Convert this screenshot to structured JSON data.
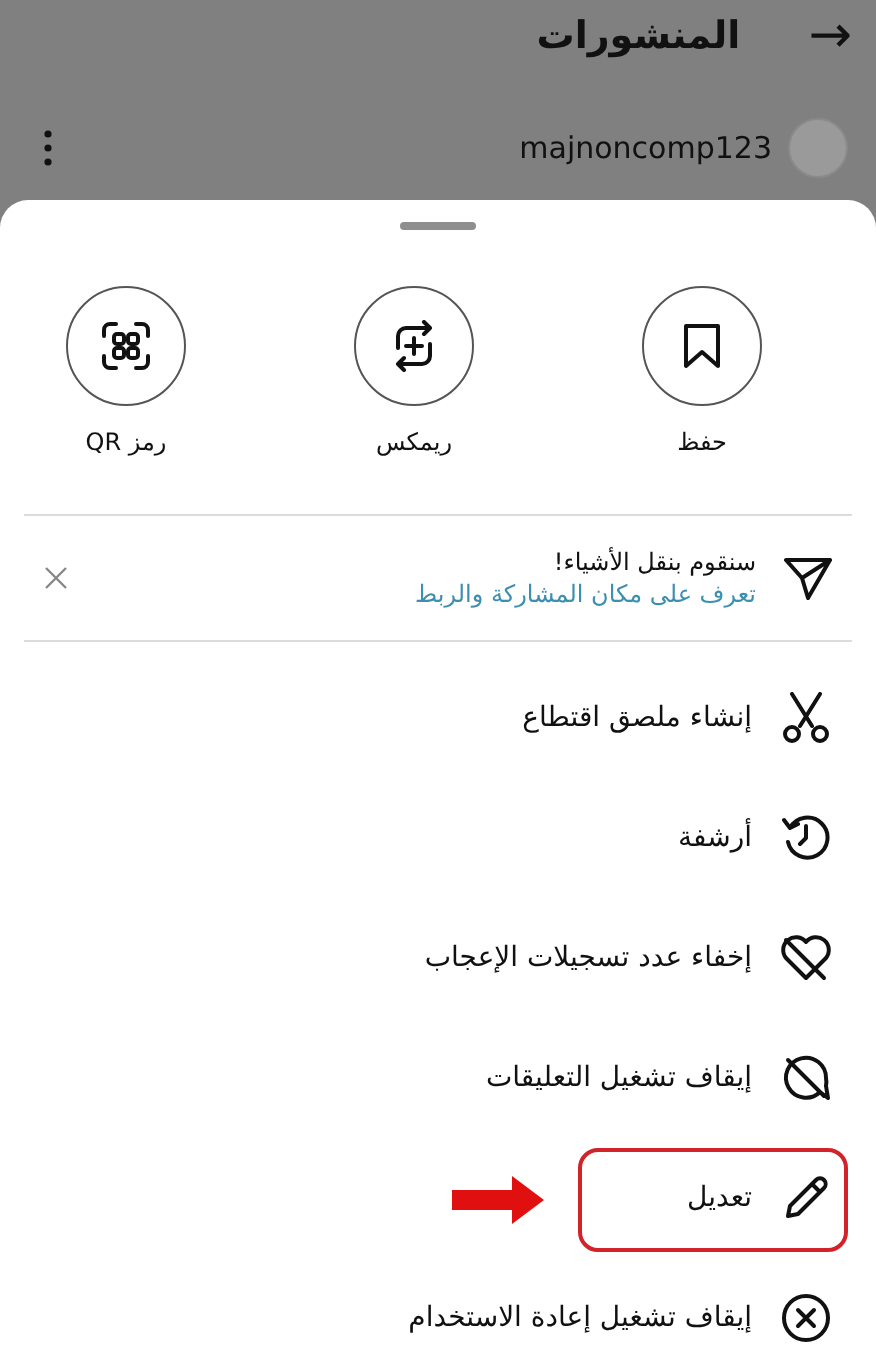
{
  "header": {
    "title": "المنشورات",
    "back_icon": "→"
  },
  "post": {
    "username": "majnoncomp123"
  },
  "quick_actions": [
    {
      "label": "حفظ"
    },
    {
      "label": "ريمكس"
    },
    {
      "label": "رمز QR"
    }
  ],
  "notice": {
    "title": "سنقوم بنقل الأشياء!",
    "link": "تعرف على مكان المشاركة والربط"
  },
  "menu": [
    {
      "label": "إنشاء ملصق اقتطاع",
      "highlighted": false
    },
    {
      "label": "أرشفة",
      "highlighted": false
    },
    {
      "label": "إخفاء عدد تسجيلات الإعجاب",
      "highlighted": false
    },
    {
      "label": "إيقاف تشغيل التعليقات",
      "highlighted": false
    },
    {
      "label": "تعديل",
      "highlighted": true
    },
    {
      "label": "إيقاف تشغيل إعادة الاستخدام",
      "highlighted": false
    }
  ]
}
